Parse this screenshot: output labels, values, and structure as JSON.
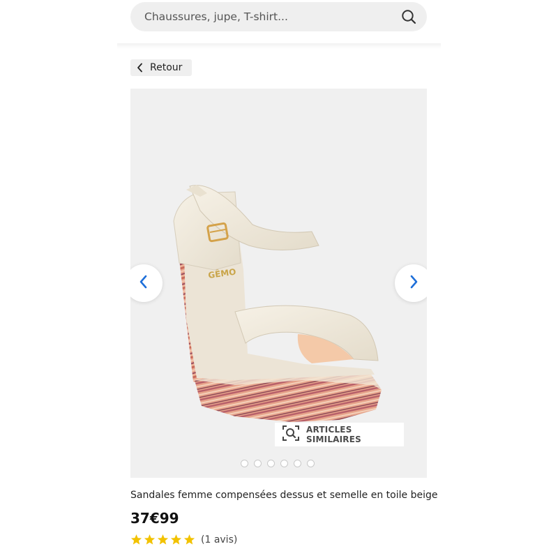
{
  "search": {
    "placeholder": "Chaussures, jupe, T-shirt..."
  },
  "nav": {
    "back_label": "Retour"
  },
  "gallery": {
    "brand_on_insole": "GÊMO",
    "similar_label": "ARTICLES SIMILAIRES",
    "slide_count": 6
  },
  "product": {
    "title": "Sandales femme compensées dessus et semelle en toile beige",
    "price": "37€99",
    "rating": {
      "stars": 5,
      "reviews_label": "(1 avis)"
    }
  },
  "colors": {
    "accent_blue": "#1e6fd9",
    "star_gold": "#f2c200",
    "search_bg": "#efefef"
  }
}
